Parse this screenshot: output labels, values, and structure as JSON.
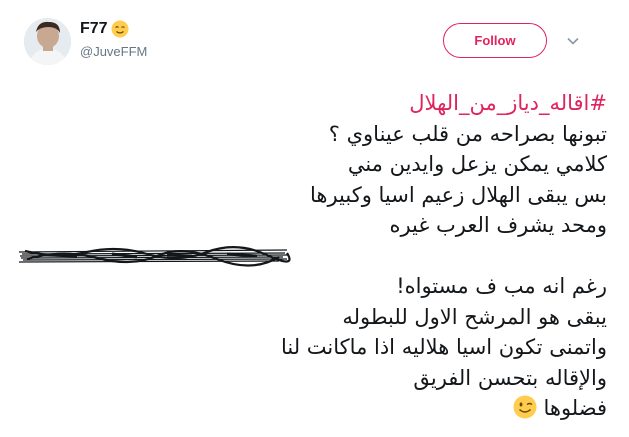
{
  "user": {
    "display_name": "F77",
    "handle": "@JuveFFM"
  },
  "follow_button": {
    "label": "Follow"
  },
  "icons": {
    "name_emoji": "relieved-face-emoji",
    "end_emoji": "winking-face-emoji",
    "more": "chevron-down-icon"
  },
  "tweet": {
    "hashtag": "#اقاله_دياز_من_الهلال",
    "lines": [
      "تبونها بصراحه من قلب عيناوي ؟",
      "كلامي يمكن يزعل وايدين مني",
      "بس يبقى الهلال زعيم اسيا وكبيرها",
      "ومحد يشرف العرب غيره",
      "رغم انه مب ف مستواه!",
      "يبقى هو المرشح الاول للبطوله",
      "واتمنى تكون اسيا هلاليه اذا ماكانت لنا",
      "والإقاله بتحسن الفريق",
      "فضلوها"
    ]
  },
  "colors": {
    "accent": "#e0245e",
    "text": "#14171a",
    "muted": "#657786"
  }
}
